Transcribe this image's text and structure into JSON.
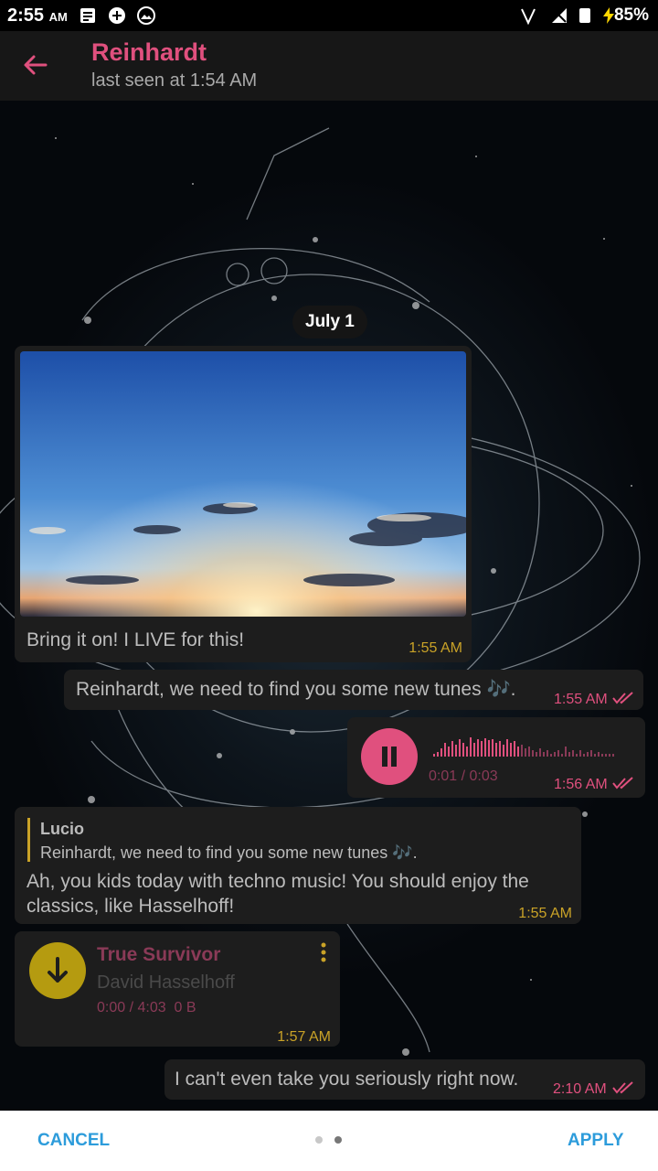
{
  "status_bar": {
    "time": "2:55",
    "ampm": "AM",
    "battery": "85%"
  },
  "header": {
    "name": "Reinhardt",
    "last_seen": "last seen at 1:54 AM"
  },
  "chat": {
    "date": "July 1",
    "photo_message": {
      "text": "Bring it on! I LIVE for this!",
      "time": "1:55 AM"
    },
    "outgoing_1": {
      "text": "Reinhardt, we need to find you some new tunes 🎶.",
      "time": "1:55 AM"
    },
    "voice": {
      "progress": "0:01 / 0:03",
      "time": "1:56 AM"
    },
    "reply_message": {
      "quote_author": "Lucio",
      "quote_text": "Reinhardt, we need to find you some new tunes 🎶.",
      "text_line1": "Ah, you kids today with techno music! You should enjoy the",
      "text_line2": "classics, like Hasselhoff!",
      "time": "1:55 AM"
    },
    "music": {
      "title": "True Survivor",
      "artist": "David Hasselhoff",
      "meta": "0:00 / 4:03  0 B",
      "time": "1:57 AM"
    },
    "outgoing_2": {
      "text": "I can't even take you seriously right now.",
      "time": "2:10 AM"
    }
  },
  "bottom_bar": {
    "cancel": "CANCEL",
    "apply": "APPLY"
  },
  "colors": {
    "accent": "#e0507e",
    "incoming_time": "#c9a227",
    "link": "#2d9cdb",
    "bubble": "#1d1d1d"
  }
}
